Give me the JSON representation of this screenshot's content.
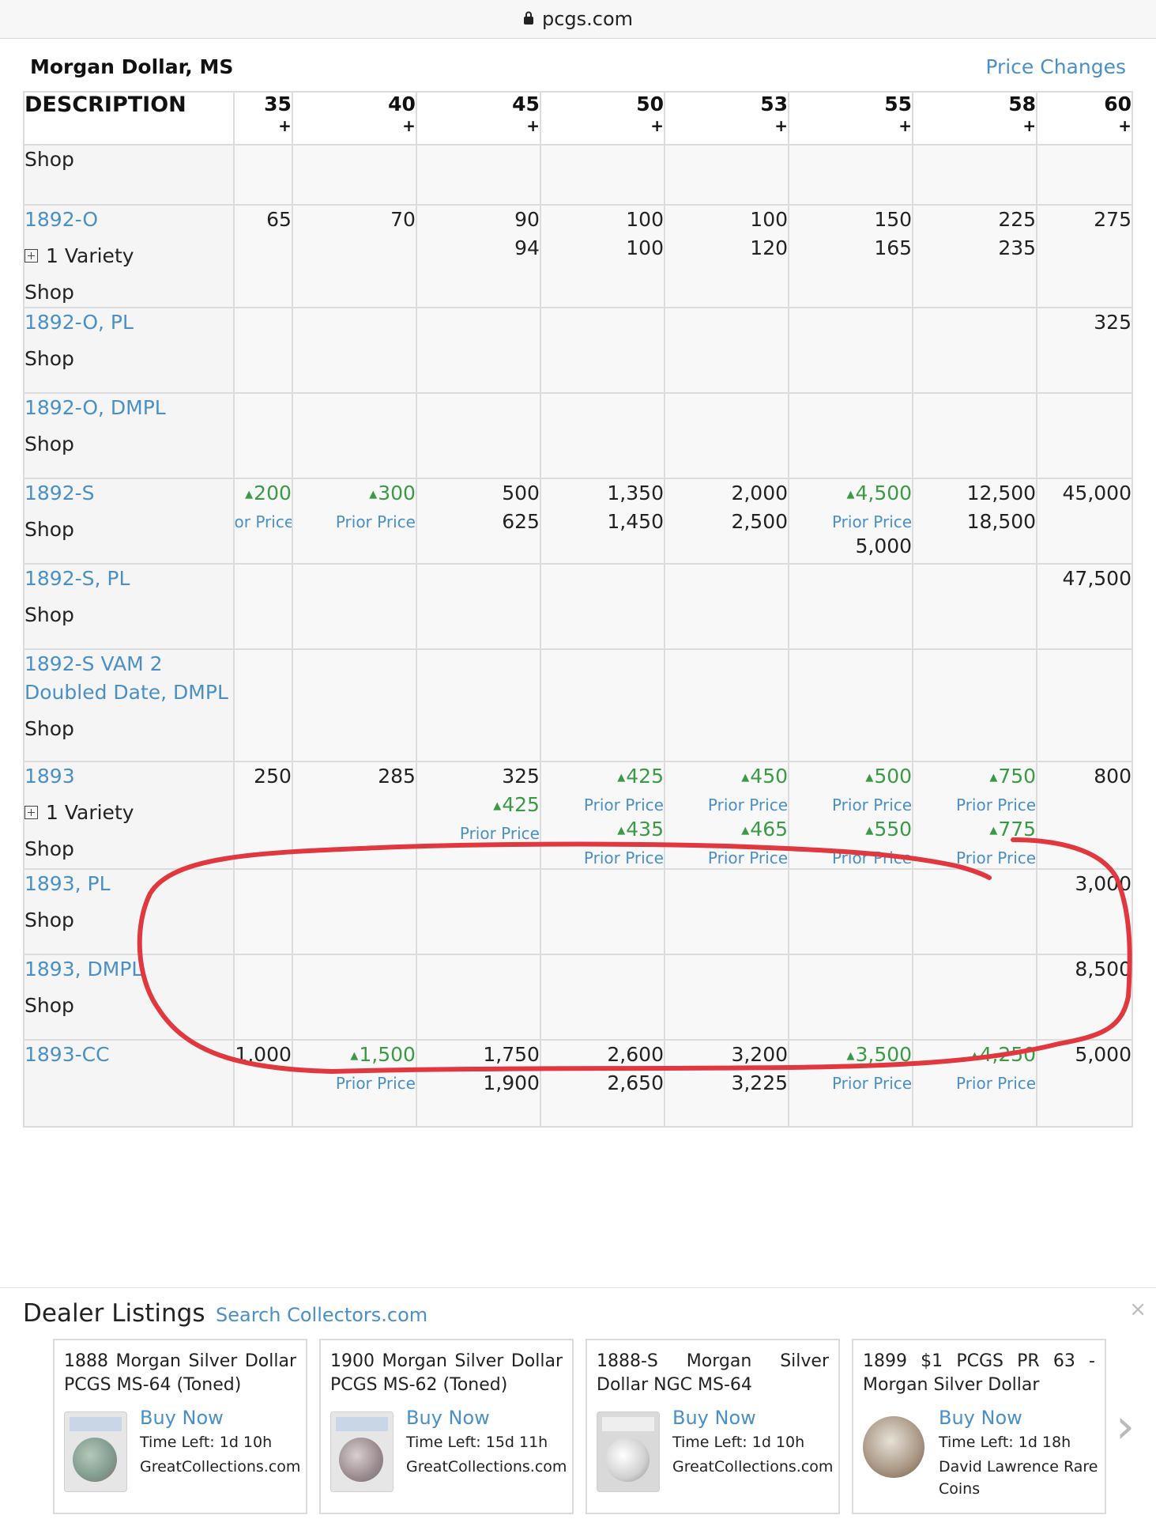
{
  "browser": {
    "url": "pcgs.com"
  },
  "page": {
    "title": "Morgan Dollar, MS",
    "price_changes": "Price Changes"
  },
  "table": {
    "description_header": "DESCRIPTION",
    "grades": [
      {
        "num": "35",
        "plus": "+"
      },
      {
        "num": "40",
        "plus": "+"
      },
      {
        "num": "45",
        "plus": "+"
      },
      {
        "num": "50",
        "plus": "+"
      },
      {
        "num": "53",
        "plus": "+"
      },
      {
        "num": "55",
        "plus": "+"
      },
      {
        "num": "58",
        "plus": "+"
      },
      {
        "num": "60",
        "plus": "+"
      }
    ],
    "rows": [
      {
        "name": "",
        "variety": "",
        "shop": "Shop",
        "cells": [
          [],
          [],
          [],
          [],
          [],
          [],
          [],
          []
        ]
      },
      {
        "name": "1892-O",
        "variety": "1 Variety",
        "shop": "Shop",
        "cells": [
          [
            {
              "t": "65"
            }
          ],
          [
            {
              "t": "70"
            }
          ],
          [
            {
              "t": "90"
            },
            {
              "t": "94"
            }
          ],
          [
            {
              "t": "100"
            },
            {
              "t": "100"
            }
          ],
          [
            {
              "t": "100"
            },
            {
              "t": "120"
            }
          ],
          [
            {
              "t": "150"
            },
            {
              "t": "165"
            }
          ],
          [
            {
              "t": "225"
            },
            {
              "t": "235"
            }
          ],
          [
            {
              "t": "275"
            }
          ]
        ]
      },
      {
        "name": "1892-O, PL",
        "variety": "",
        "shop": "Shop",
        "cells": [
          [],
          [],
          [],
          [],
          [],
          [],
          [],
          [
            {
              "t": "325"
            }
          ]
        ]
      },
      {
        "name": "1892-O, DMPL",
        "variety": "",
        "shop": "Shop",
        "cells": [
          [],
          [],
          [],
          [],
          [],
          [],
          [],
          []
        ]
      },
      {
        "name": "1892-S",
        "variety": "",
        "shop": "Shop",
        "cells": [
          [
            {
              "t": "200",
              "up": true
            },
            {
              "p": "or Price"
            }
          ],
          [
            {
              "t": "300",
              "up": true
            },
            {
              "p": "Prior Price"
            }
          ],
          [
            {
              "t": "500"
            },
            {
              "t": "625"
            }
          ],
          [
            {
              "t": "1,350"
            },
            {
              "t": "1,450"
            }
          ],
          [
            {
              "t": "2,000"
            },
            {
              "t": "2,500"
            }
          ],
          [
            {
              "t": "4,500",
              "up": true
            },
            {
              "p": "Prior Price"
            },
            {
              "t": "5,000"
            }
          ],
          [
            {
              "t": "12,500"
            },
            {
              "t": "18,500"
            }
          ],
          [
            {
              "t": "45,000"
            }
          ]
        ]
      },
      {
        "name": "1892-S, PL",
        "variety": "",
        "shop": "Shop",
        "cells": [
          [],
          [],
          [],
          [],
          [],
          [],
          [],
          [
            {
              "t": "47,500"
            }
          ]
        ]
      },
      {
        "name": "1892-S VAM 2 Doubled Date, DMPL",
        "variety": "",
        "shop": "Shop",
        "cells": [
          [],
          [],
          [],
          [],
          [],
          [],
          [],
          []
        ]
      },
      {
        "name": "1893",
        "variety": "1 Variety",
        "shop": "Shop",
        "cells": [
          [
            {
              "t": "250"
            }
          ],
          [
            {
              "t": "285"
            }
          ],
          [
            {
              "t": "325"
            },
            {
              "t": "425",
              "up": true
            },
            {
              "p": "Prior Price"
            }
          ],
          [
            {
              "t": "425",
              "up": true
            },
            {
              "p": "Prior Price"
            },
            {
              "t": "435",
              "up": true
            },
            {
              "p": "Prior Price"
            }
          ],
          [
            {
              "t": "450",
              "up": true
            },
            {
              "p": "Prior Price"
            },
            {
              "t": "465",
              "up": true
            },
            {
              "p": "Prior Price"
            }
          ],
          [
            {
              "t": "500",
              "up": true
            },
            {
              "p": "Prior Price"
            },
            {
              "t": "550",
              "up": true
            },
            {
              "p": "Prior Price"
            }
          ],
          [
            {
              "t": "750",
              "up": true
            },
            {
              "p": "Prior Price"
            },
            {
              "t": "775",
              "up": true
            },
            {
              "p": "Prior Price"
            }
          ],
          [
            {
              "t": "800"
            }
          ]
        ]
      },
      {
        "name": "1893, PL",
        "variety": "",
        "shop": "Shop",
        "cells": [
          [],
          [],
          [],
          [],
          [],
          [],
          [],
          [
            {
              "t": "3,000"
            }
          ]
        ]
      },
      {
        "name": "1893, DMPL",
        "variety": "",
        "shop": "Shop",
        "cells": [
          [],
          [],
          [],
          [],
          [],
          [],
          [],
          [
            {
              "t": "8,500"
            }
          ]
        ]
      },
      {
        "name": "1893-CC",
        "variety": "",
        "shop": "",
        "cells": [
          [
            {
              "t": "1,000"
            }
          ],
          [
            {
              "t": "1,500",
              "up": true
            },
            {
              "p": "Prior Price"
            }
          ],
          [
            {
              "t": "1,750"
            },
            {
              "t": "1,900"
            }
          ],
          [
            {
              "t": "2,600"
            },
            {
              "t": "2,650"
            }
          ],
          [
            {
              "t": "3,200"
            },
            {
              "t": "3,225"
            }
          ],
          [
            {
              "t": "3,500",
              "up": true
            },
            {
              "p": "Prior Price"
            }
          ],
          [
            {
              "t": "4,250",
              "up": true
            },
            {
              "p": "Prior Price"
            }
          ],
          [
            {
              "t": "5,000"
            }
          ]
        ]
      }
    ]
  },
  "dealer": {
    "title": "Dealer Listings",
    "search": "Search Collectors.com",
    "close": "×",
    "listings": [
      {
        "title": "1888 Morgan Silver Dollar PCGS MS-64 (Toned)",
        "buy": "Buy Now",
        "time": "Time Left: 1d 10h",
        "seller": "GreatCollections.com"
      },
      {
        "title": "1900 Morgan Silver Dollar PCGS MS-62 (Toned)",
        "buy": "Buy Now",
        "time": "Time Left: 15d 11h",
        "seller": "GreatCollections.com"
      },
      {
        "title": "1888-S Morgan Silver Dollar NGC MS-64",
        "buy": "Buy Now",
        "time": "Time Left: 1d 10h",
        "seller": "GreatCollections.com"
      },
      {
        "title": "1899 $1 PCGS PR 63 - Morgan Silver Dollar",
        "buy": "Buy Now",
        "time": "Time Left: 1d 18h",
        "seller": "David Lawrence Rare Coins"
      }
    ],
    "next": "›"
  },
  "colors": {
    "link": "#4a8fc6",
    "up": "#3a9a45",
    "annotation": "#e0383e"
  }
}
